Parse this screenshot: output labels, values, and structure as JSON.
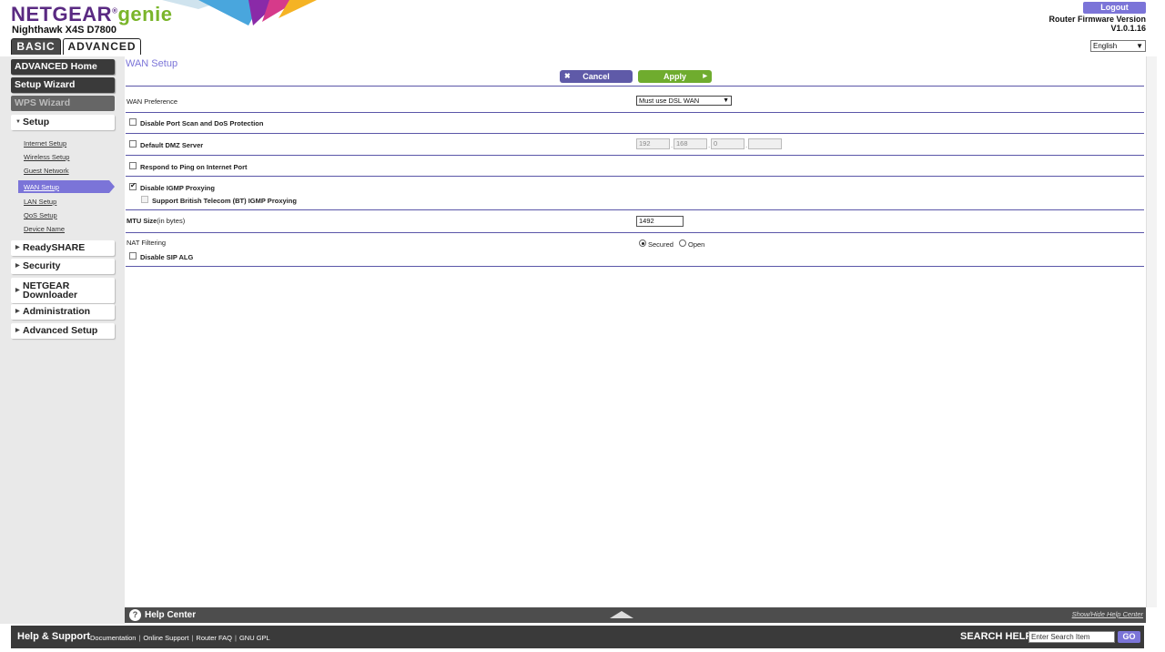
{
  "header": {
    "brand_main": "NETGEAR",
    "brand_genie": "genie",
    "trademark": "®",
    "model": "Nighthawk X4S D7800",
    "tabs": {
      "basic": "BASIC",
      "advanced": "ADVANCED"
    },
    "logout": "Logout",
    "firmware_label": "Router Firmware Version",
    "firmware_version": "V1.0.1.16",
    "language": "English"
  },
  "sidebar": {
    "advanced_home": "ADVANCED Home",
    "setup_wizard": "Setup Wizard",
    "wps_wizard": "WPS Wizard",
    "setup": "Setup",
    "setup_items": [
      "Internet Setup",
      "Wireless Setup",
      "Guest Network",
      "WAN Setup",
      "LAN Setup",
      "QoS Setup",
      "Device Name"
    ],
    "readyshare": "ReadySHARE",
    "security": "Security",
    "downloader_line1": "NETGEAR",
    "downloader_line2": "Downloader",
    "administration": "Administration",
    "advanced_setup": "Advanced Setup"
  },
  "main": {
    "title": "WAN Setup",
    "cancel": "Cancel",
    "apply": "Apply",
    "wan_preference_label": "WAN Preference",
    "wan_preference_value": "Must use DSL WAN",
    "disable_port_scan": "Disable Port Scan and DoS Protection",
    "default_dmz": "Default DMZ Server",
    "dmz_ip": [
      "192",
      "168",
      "0",
      ""
    ],
    "respond_ping": "Respond to Ping on Internet Port",
    "disable_igmp": "Disable IGMP Proxying",
    "bt_igmp": "Support British Telecom (BT) IGMP Proxying",
    "mtu_label": "MTU Size",
    "mtu_unit": "(in bytes)",
    "mtu_value": "1492",
    "nat_label": "NAT Filtering",
    "nat_secured": "Secured",
    "nat_open": "Open",
    "disable_sip": "Disable SIP ALG"
  },
  "helpbar": {
    "label": "Help Center",
    "toggle": "Show/Hide Help Center"
  },
  "footer": {
    "help_support": "Help & Support",
    "links": [
      "Documentation",
      "Online Support",
      "Router FAQ",
      "GNU GPL"
    ],
    "search_label": "SEARCH HELP",
    "search_placeholder": "Enter Search Item",
    "go": "GO"
  },
  "colors": {
    "accent": "#7b74d8",
    "brand_purple": "#5a2a82",
    "genie_green": "#7ab52a",
    "apply_green": "#6fac2e",
    "dark_nav": "#3a3a3a"
  }
}
